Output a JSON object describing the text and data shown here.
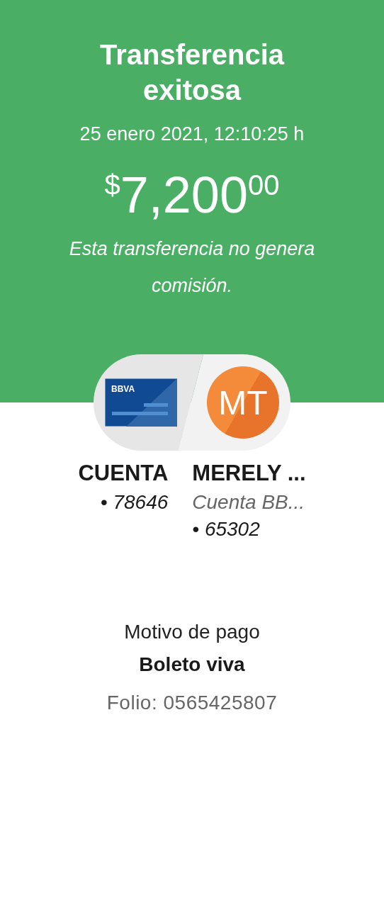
{
  "header": {
    "title": "Transferencia exitosa",
    "date": "25 enero 2021, 12:10:25 h",
    "amount": {
      "currency": "$",
      "whole": "7,200",
      "cents": "00"
    },
    "note": "Esta transferencia no genera comisión."
  },
  "origin": {
    "card_brand": "BBVA",
    "name": "CUENTA",
    "lines": [
      "• 78646"
    ]
  },
  "destination": {
    "initials": "MT",
    "name": "MERELY ...",
    "lines": [
      "Cuenta BB...",
      "• 65302"
    ]
  },
  "payment": {
    "label": "Motivo de pago",
    "reason": "Boleto viva",
    "folio": "Folio: 0565425807"
  }
}
